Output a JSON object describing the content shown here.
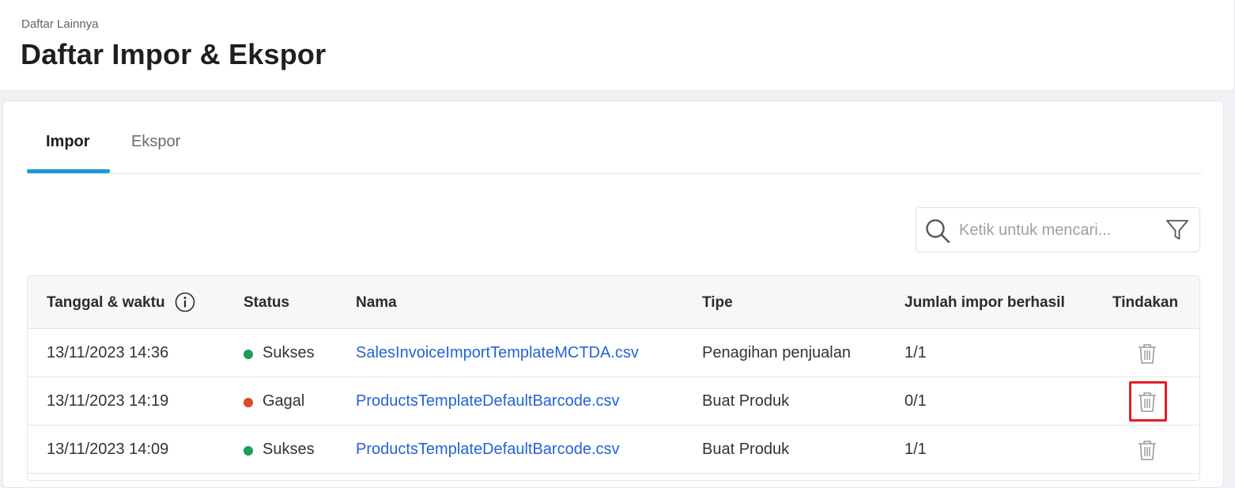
{
  "header": {
    "breadcrumb": "Daftar Lainnya",
    "title": "Daftar Impor & Ekspor"
  },
  "tabs": [
    {
      "label": "Impor",
      "active": true
    },
    {
      "label": "Ekspor",
      "active": false
    }
  ],
  "search": {
    "placeholder": "Ketik untuk mencari...",
    "value": ""
  },
  "table": {
    "columns": [
      "Tanggal & waktu",
      "Status",
      "Nama",
      "Tipe",
      "Jumlah impor berhasil",
      "Tindakan"
    ],
    "rows": [
      {
        "datetime": "13/11/2023 14:36",
        "status": "Sukses",
        "status_color": "#1a9e5c",
        "name": "SalesInvoiceImportTemplateMCTDA.csv",
        "type": "Penagihan penjualan",
        "count": "1/1",
        "highlighted": false
      },
      {
        "datetime": "13/11/2023 14:19",
        "status": "Gagal",
        "status_color": "#e0472b",
        "name": "ProductsTemplateDefaultBarcode.csv",
        "type": "Buat Produk",
        "count": "0/1",
        "highlighted": true
      },
      {
        "datetime": "13/11/2023 14:09",
        "status": "Sukses",
        "status_color": "#1a9e5c",
        "name": "ProductsTemplateDefaultBarcode.csv",
        "type": "Buat Produk",
        "count": "1/1",
        "highlighted": false
      }
    ]
  },
  "colors": {
    "accent": "#1a9ad6",
    "link": "#2563d6",
    "success": "#1a9e5c",
    "failure": "#e0472b",
    "highlight": "#e11d2a"
  },
  "icons": [
    "search-icon",
    "filter-icon",
    "info-icon",
    "trash-icon"
  ]
}
